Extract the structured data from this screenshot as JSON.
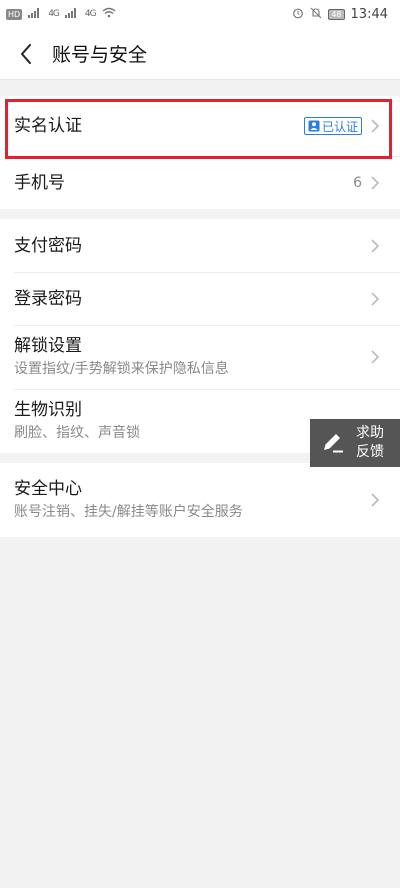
{
  "status_bar": {
    "hd_label": "HD",
    "sig1": "4G",
    "sig2": "4G",
    "battery": "48",
    "time": "13:44"
  },
  "header": {
    "title": "账号与安全"
  },
  "rows": {
    "realname": {
      "label": "实名认证",
      "badge": "已认证"
    },
    "phone": {
      "label": "手机号",
      "value": "6"
    },
    "pay_password": {
      "label": "支付密码"
    },
    "login_password": {
      "label": "登录密码"
    },
    "unlock": {
      "label": "解锁设置",
      "sub": "设置指纹/手势解锁来保护隐私信息"
    },
    "biometric": {
      "label": "生物识别",
      "sub": "刷脸、指纹、声音锁"
    },
    "security_center": {
      "label": "安全中心",
      "sub": "账号注销、挂失/解挂等账户安全服务"
    }
  },
  "help": {
    "line1": "求助",
    "line2": "反馈"
  },
  "colors": {
    "accent": "#2a7de1",
    "highlight": "#e4202e",
    "float_bg": "#555555"
  }
}
